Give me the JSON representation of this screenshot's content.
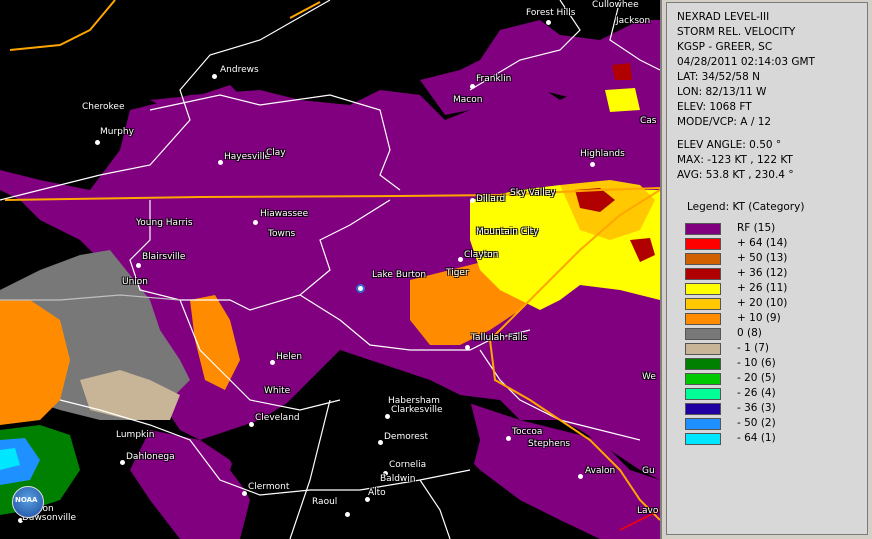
{
  "panel": {
    "lines": [
      "NEXRAD LEVEL-III",
      "STORM REL. VELOCITY",
      "KGSP - GREER, SC",
      "04/28/2011 02:14:03 GMT",
      "LAT: 34/52/58 N",
      "LON: 82/13/11 W",
      "ELEV: 1068 FT",
      "MODE/VCP: A / 12"
    ],
    "stats": [
      "ELEV ANGLE: 0.50 °",
      "MAX: -123 KT , 122 KT",
      "AVG: 53.8 KT , 230.4 °"
    ],
    "legend_title": "Legend: KT (Category)",
    "legend": [
      {
        "label": "RF  (15)",
        "color": "#800080"
      },
      {
        "label": "+ 64  (14)",
        "color": "#ff0000"
      },
      {
        "label": "+ 50  (13)",
        "color": "#d06000"
      },
      {
        "label": "+ 36  (12)",
        "color": "#b00000"
      },
      {
        "label": "+ 26  (11)",
        "color": "#ffff00"
      },
      {
        "label": "+ 20  (10)",
        "color": "#ffc800"
      },
      {
        "label": "+ 10  (9)",
        "color": "#ff8c00"
      },
      {
        "label": "0  (8)",
        "color": "#787878"
      },
      {
        "label": "- 1  (7)",
        "color": "#c8b496"
      },
      {
        "label": "- 10  (6)",
        "color": "#008000"
      },
      {
        "label": "- 20  (5)",
        "color": "#00c800"
      },
      {
        "label": "- 26  (4)",
        "color": "#00ff96"
      },
      {
        "label": "- 36  (3)",
        "color": "#2000a0"
      },
      {
        "label": "- 50  (2)",
        "color": "#1e90ff"
      },
      {
        "label": "- 64  (1)",
        "color": "#00e6ff"
      }
    ]
  },
  "map": {
    "logo_text": "NOAA",
    "radar_site_name": "Lake Burton",
    "towns": [
      {
        "name": "Forest Hills"
      },
      {
        "name": "Cullowhee"
      },
      {
        "name": "Jackson"
      },
      {
        "name": "Andrews"
      },
      {
        "name": "Cherokee"
      },
      {
        "name": "Murphy"
      },
      {
        "name": "Franklin"
      },
      {
        "name": "Macon"
      },
      {
        "name": "Cas"
      },
      {
        "name": "Hayesville"
      },
      {
        "name": "Clay"
      },
      {
        "name": "Highlands"
      },
      {
        "name": "Sky Valley"
      },
      {
        "name": "Dillard"
      },
      {
        "name": "Young Harris"
      },
      {
        "name": "Hiawassee"
      },
      {
        "name": "Towns"
      },
      {
        "name": "Mountain City"
      },
      {
        "name": "Clayton"
      },
      {
        "name": "Blairsville"
      },
      {
        "name": "Union"
      },
      {
        "name": "Tiger"
      },
      {
        "name": "Tallulah Falls"
      },
      {
        "name": "Helen"
      },
      {
        "name": "White"
      },
      {
        "name": "We"
      },
      {
        "name": "Habersham"
      },
      {
        "name": "Clarkesville"
      },
      {
        "name": "Cleveland"
      },
      {
        "name": "Lumpkin"
      },
      {
        "name": "Toccoa"
      },
      {
        "name": "Stephens"
      },
      {
        "name": "Demorest"
      },
      {
        "name": "Dahlonega"
      },
      {
        "name": "Cornelia"
      },
      {
        "name": "Baldwin"
      },
      {
        "name": "Avalon"
      },
      {
        "name": "Gu"
      },
      {
        "name": "Clermont"
      },
      {
        "name": "Raoul"
      },
      {
        "name": "Alto"
      },
      {
        "name": "Dawson"
      },
      {
        "name": "Dawsonville"
      },
      {
        "name": "Lavo"
      }
    ]
  }
}
